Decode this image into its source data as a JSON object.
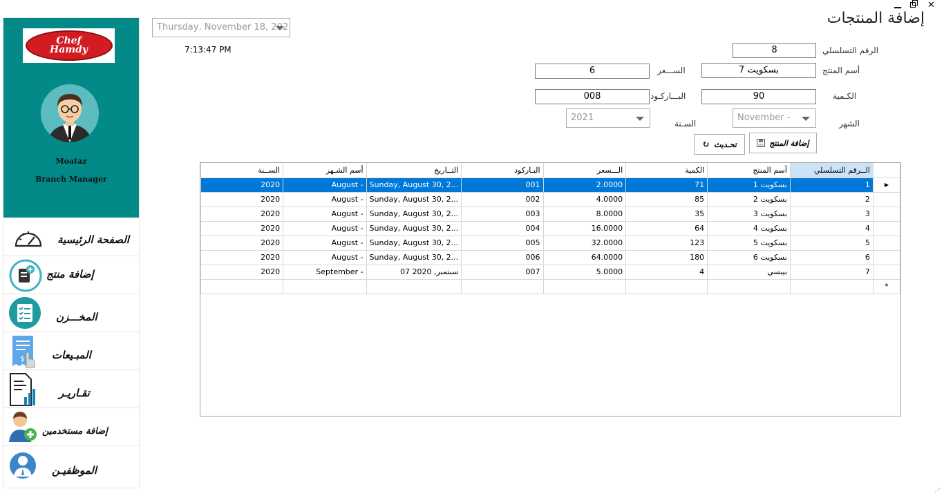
{
  "window": {
    "minimize": "▁",
    "restore": "🗗",
    "close": "✕"
  },
  "sidebar": {
    "logo_text_1": "Chef",
    "logo_text_2": "Hamdy",
    "user_name": "Moataz",
    "user_role": "Branch Manager",
    "items": [
      {
        "label": "الصفحة الرئيسية",
        "icon": "speedometer-icon"
      },
      {
        "label": "إضافة منتج",
        "icon": "add-product-icon"
      },
      {
        "label": "المخـــزن",
        "icon": "inventory-list-icon"
      },
      {
        "label": "المبـيعات",
        "icon": "sales-receipt-icon"
      },
      {
        "label": "تقـاريـر",
        "icon": "reports-chart-icon"
      },
      {
        "label": "إضافة مستخدمين",
        "icon": "add-user-icon"
      },
      {
        "label": "الموظفيـن",
        "icon": "employee-icon"
      }
    ]
  },
  "header": {
    "date_value": "Thursday, November 18, 202",
    "time_value": "7:13:47 PM",
    "page_title": "إضافة المنتجات"
  },
  "form": {
    "serial_label": "الرقم التسلسلي",
    "serial_value": "8",
    "product_name_label": "أسم المنتج",
    "product_name_value": "بسكويت 7",
    "price_label": "الســـعر",
    "price_value": "6",
    "quantity_label": "الكـمية",
    "quantity_value": "90",
    "barcode_label": "البـــاركـود",
    "barcode_value": "008",
    "month_label": "الشهر",
    "month_value": "November -",
    "year_label": "السـنة",
    "year_value": "2021",
    "add_button": "إضافة المنتج",
    "refresh_button": "تحـديث"
  },
  "grid": {
    "columns": [
      "الــرقم التسلسلي",
      "أسم المنتج",
      "الكمية",
      "الـــسعر",
      "البـاركود",
      "التــاريخ",
      "أسم الشـهر",
      "الســنة"
    ],
    "rows": [
      [
        "1",
        "بسكويت 1",
        "71",
        "2.0000",
        "001",
        "Sunday, August 30, 2...",
        "August -",
        "2020"
      ],
      [
        "2",
        "بسكويت 2",
        "85",
        "4.0000",
        "002",
        "Sunday, August 30, 2...",
        "August -",
        "2020"
      ],
      [
        "3",
        "بسكويت 3",
        "35",
        "8.0000",
        "003",
        "Sunday, August 30, 2...",
        "August -",
        "2020"
      ],
      [
        "4",
        "بسكويت 4",
        "64",
        "16.0000",
        "004",
        "Sunday, August 30, 2...",
        "August -",
        "2020"
      ],
      [
        "5",
        "بسكويت 5",
        "123",
        "32.0000",
        "005",
        "Sunday, August 30, 2...",
        "August -",
        "2020"
      ],
      [
        "6",
        "بسكويت 6",
        "180",
        "64.0000",
        "006",
        "Sunday, August 30, 2...",
        "August -",
        "2020"
      ],
      [
        "7",
        "بيبسي",
        "4",
        "5.0000",
        "007",
        "07 سبتمبر, 2020",
        "September -",
        "2020"
      ]
    ],
    "current_row_marker": "▶",
    "new_row_marker": "*"
  },
  "colors": {
    "sidebar_bg": "#038a88",
    "selection": "#0078d7",
    "header_selected": "#cce3f7"
  }
}
